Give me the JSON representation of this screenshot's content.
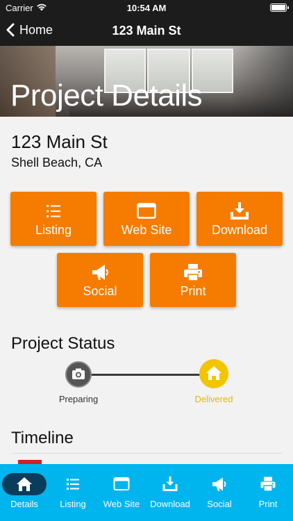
{
  "status_bar": {
    "carrier": "Carrier",
    "time": "10:54 AM"
  },
  "nav": {
    "back_label": "Home",
    "title": "123 Main St"
  },
  "hero": {
    "title": "Project Details"
  },
  "address": {
    "street": "123 Main St",
    "city": "Shell Beach, CA"
  },
  "actions": [
    {
      "label": "Listing",
      "icon": "list-icon"
    },
    {
      "label": "Web Site",
      "icon": "browser-window-icon"
    },
    {
      "label": "Download",
      "icon": "download-icon"
    },
    {
      "label": "Social",
      "icon": "megaphone-icon"
    },
    {
      "label": "Print",
      "icon": "printer-icon"
    }
  ],
  "project_status": {
    "title": "Project Status",
    "steps": [
      {
        "label": "Preparing",
        "icon": "camera-icon",
        "color": "#555555"
      },
      {
        "label": "Delivered",
        "icon": "home-icon",
        "color": "#f2c500",
        "active": true
      }
    ]
  },
  "timeline": {
    "title": "Timeline"
  },
  "tabs": [
    {
      "label": "Details",
      "icon": "home-icon",
      "selected": true
    },
    {
      "label": "Listing",
      "icon": "list-icon"
    },
    {
      "label": "Web Site",
      "icon": "browser-window-icon"
    },
    {
      "label": "Download",
      "icon": "download-icon"
    },
    {
      "label": "Social",
      "icon": "megaphone-icon"
    },
    {
      "label": "Print",
      "icon": "printer-icon"
    }
  ],
  "colors": {
    "accent_orange": "#f57c00",
    "tab_bar": "#00b5ee",
    "tab_selected_pill": "#0a3d5c",
    "status_active": "#f2c500",
    "nav_background": "#1c1c1c"
  }
}
